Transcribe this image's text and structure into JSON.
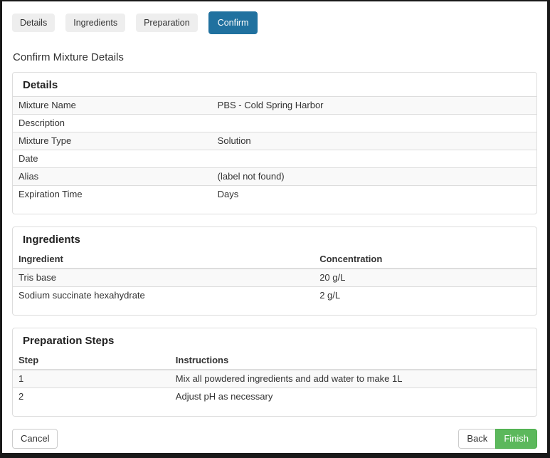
{
  "tabs": [
    {
      "label": "Details",
      "active": false
    },
    {
      "label": "Ingredients",
      "active": false
    },
    {
      "label": "Preparation",
      "active": false
    },
    {
      "label": "Confirm",
      "active": true
    }
  ],
  "page_title": "Confirm Mixture Details",
  "details": {
    "heading": "Details",
    "rows": [
      {
        "label": "Mixture Name",
        "value": "PBS - Cold Spring Harbor"
      },
      {
        "label": "Description",
        "value": ""
      },
      {
        "label": "Mixture Type",
        "value": "Solution"
      },
      {
        "label": "Date",
        "value": ""
      },
      {
        "label": "Alias",
        "value": "(label not found)"
      },
      {
        "label": "Expiration Time",
        "value": "Days"
      }
    ]
  },
  "ingredients": {
    "heading": "Ingredients",
    "columns": {
      "ingredient": "Ingredient",
      "concentration": "Concentration"
    },
    "rows": [
      {
        "ingredient": "Tris base",
        "concentration": "20 g/L"
      },
      {
        "ingredient": "Sodium succinate hexahydrate",
        "concentration": "2 g/L"
      }
    ]
  },
  "preparation": {
    "heading": "Preparation Steps",
    "columns": {
      "step": "Step",
      "instructions": "Instructions"
    },
    "rows": [
      {
        "step": "1",
        "instructions": "Mix all powdered ingredients and add water to make 1L"
      },
      {
        "step": "2",
        "instructions": "Adjust pH as necessary"
      }
    ]
  },
  "footer": {
    "cancel_label": "Cancel",
    "back_label": "Back",
    "finish_label": "Finish"
  },
  "colors": {
    "active_tab_bg": "#20719f",
    "active_tab_text": "#ffffff",
    "finish_bg": "#5cb85c",
    "finish_border": "#4cae4c",
    "row_stripe": "#f9f9f9",
    "panel_border": "#dddddd"
  }
}
